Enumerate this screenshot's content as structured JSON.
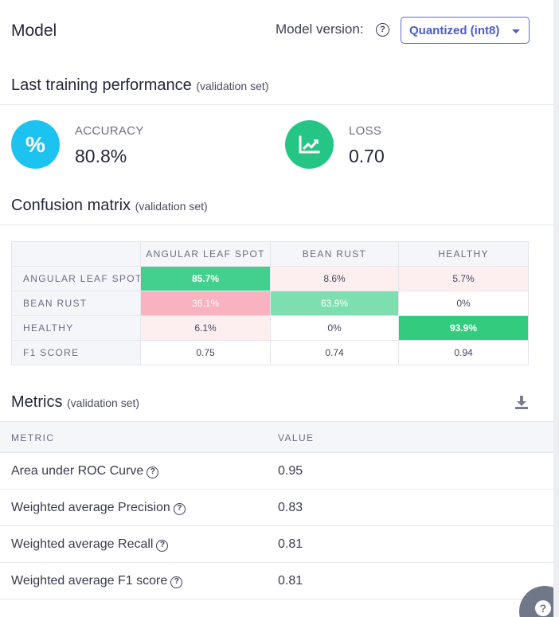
{
  "header": {
    "title": "Model",
    "model_version_label": "Model version:",
    "model_version_selected": "Quantized (int8)"
  },
  "performance": {
    "title": "Last training performance",
    "subtitle": "(validation set)",
    "accuracy": {
      "label": "ACCURACY",
      "value": "80.8%",
      "icon": "percent-icon",
      "color": "#1cc3f0"
    },
    "loss": {
      "label": "LOSS",
      "value": "0.70",
      "icon": "chart-line-icon",
      "color": "#25c586"
    }
  },
  "confusion_matrix": {
    "title": "Confusion matrix",
    "subtitle": "(validation set)",
    "columns": [
      "ANGULAR LEAF SPOT",
      "BEAN RUST",
      "HEALTHY"
    ],
    "rows": [
      {
        "label": "ANGULAR LEAF SPOT",
        "cells": [
          "85.7%",
          "8.6%",
          "5.7%"
        ]
      },
      {
        "label": "BEAN RUST",
        "cells": [
          "36.1%",
          "63.9%",
          "0%"
        ]
      },
      {
        "label": "HEALTHY",
        "cells": [
          "6.1%",
          "0%",
          "93.9%"
        ]
      },
      {
        "label": "F1 SCORE",
        "cells": [
          "0.75",
          "0.74",
          "0.94"
        ]
      }
    ],
    "colors": {
      "strong_green": "#43d08f",
      "mid_green": "#7ddfb0",
      "bright_green": "#33cc7f",
      "light_pink": "#fdeef0",
      "pink": "#f8b2c0"
    }
  },
  "metrics": {
    "title": "Metrics",
    "subtitle": "(validation set)",
    "download_icon": "download-icon",
    "columns": [
      "METRIC",
      "VALUE"
    ],
    "rows": [
      {
        "name": "Area under ROC Curve",
        "value": "0.95"
      },
      {
        "name": "Weighted average Precision",
        "value": "0.83"
      },
      {
        "name": "Weighted average Recall",
        "value": "0.81"
      },
      {
        "name": "Weighted average F1 score",
        "value": "0.81"
      }
    ]
  },
  "help_fab_icon": "question-mark-icon"
}
